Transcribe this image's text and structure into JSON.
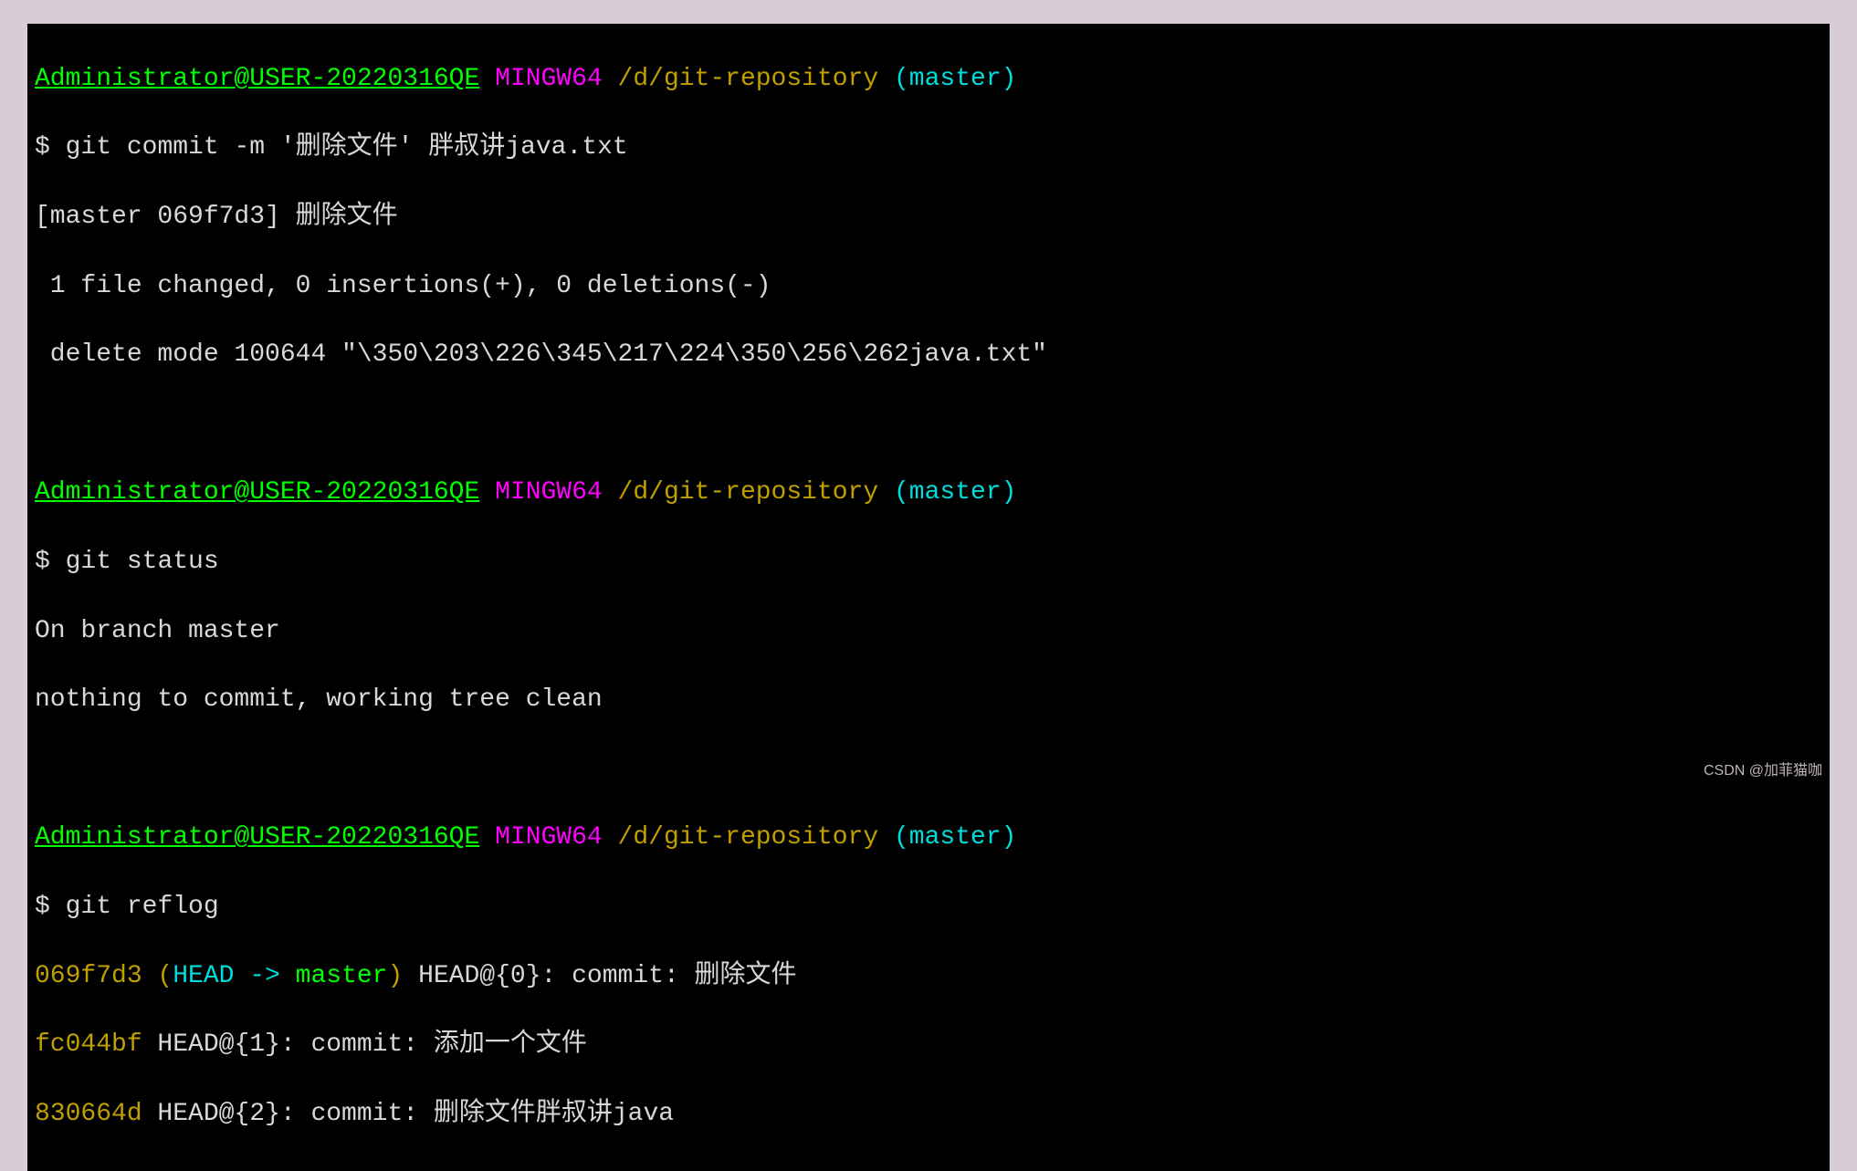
{
  "prompt": {
    "user": "Administrator@USER-20220316QE",
    "env": "MINGW64",
    "path": "/d/git-repository",
    "branch": "(master)",
    "dollar": "$"
  },
  "blocks": [
    {
      "command": "git commit -m '删除文件' 胖叔讲java.txt",
      "output": [
        "[master 069f7d3] 删除文件",
        " 1 file changed, 0 insertions(+), 0 deletions(-)",
        " delete mode 100644 \"\\350\\203\\226\\345\\217\\224\\350\\256\\262java.txt\""
      ]
    },
    {
      "command": "git status",
      "output": [
        "On branch master",
        "nothing to commit, working tree clean"
      ]
    },
    {
      "command": "git reflog",
      "reflog": [
        {
          "hash": "069f7d3",
          "head_open": " (",
          "head_label": "HEAD -> ",
          "head_ref": "master",
          "head_close": ")",
          "rest": " HEAD@{0}: commit: 删除文件"
        },
        {
          "hash": "fc044bf",
          "rest": " HEAD@{1}: commit: 添加一个文件"
        },
        {
          "hash": "830664d",
          "rest": " HEAD@{2}: commit: 删除文件胖叔讲java"
        }
      ]
    }
  ],
  "watermark": "CSDN @加菲猫咖"
}
